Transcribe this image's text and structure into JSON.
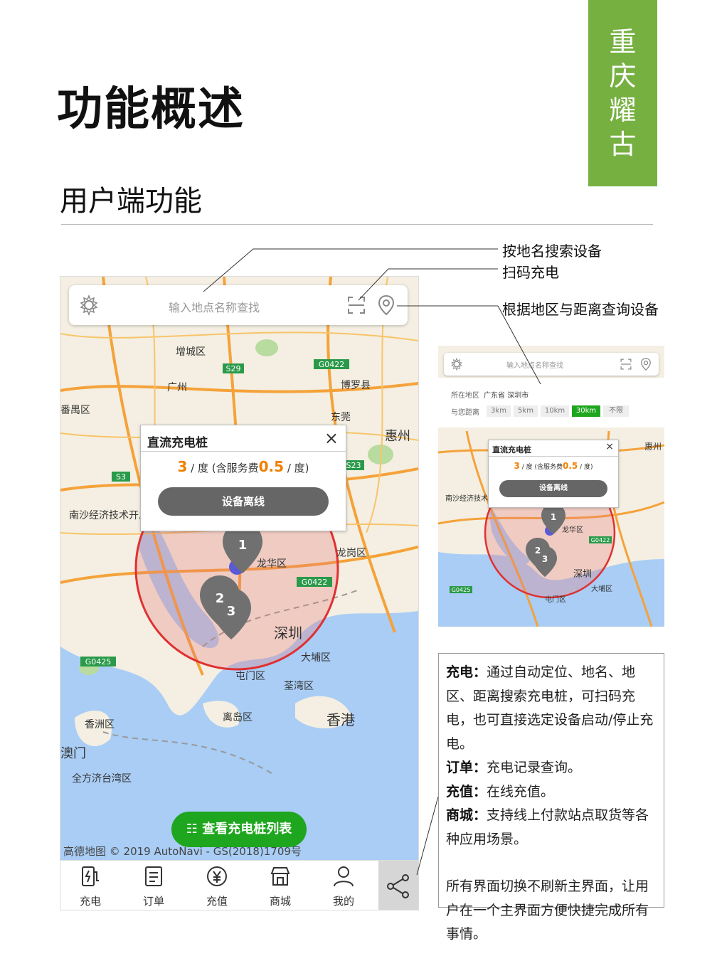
{
  "brand": {
    "chars": [
      "重",
      "庆",
      "耀",
      "古"
    ],
    "color": "#76b041"
  },
  "page_title": "功能概述",
  "section_title": "用户端功能",
  "search": {
    "placeholder": "输入地点名称查找"
  },
  "popup": {
    "title": "直流充电桩",
    "close": "×",
    "price_value": "3",
    "price_mid": " / 度 (含服务费",
    "service_fee": "0.5",
    "price_unit": " / 度)",
    "offline_button": "设备离线"
  },
  "map_labels": {
    "zengcheng": "增城区",
    "guangzhou": "广州",
    "huizhou": "惠州",
    "bolou": "博罗县",
    "nansha": "南沙经济技术开发区",
    "longhua": "龙华区",
    "longgang": "龙岗区",
    "shenzhen": "深圳",
    "dapeng": "大埔区",
    "tunmen": "屯门区",
    "quanwan": "荃湾区",
    "lidao": "离岛区",
    "hongkong": "香港",
    "xiangzhou": "香洲区",
    "macau": "澳门",
    "hengqin": "全方济台湾区",
    "dongguan": "东莞",
    "panyu": "番禺区",
    "road_s29": "S29",
    "road_g0422": "G0422",
    "road_s3": "S3",
    "road_g0425": "G0425",
    "road_23": "S23",
    "road_g0422b": "G0422"
  },
  "markers": [
    "1",
    "2",
    "3"
  ],
  "list_button": "☷ 查看充电桩列表",
  "copyright": "高德地图 © 2019 AutoNavi - GS(2018)1709号",
  "tabs": [
    {
      "label": "充电",
      "icon": "charge-icon"
    },
    {
      "label": "订单",
      "icon": "order-icon"
    },
    {
      "label": "充值",
      "icon": "recharge-icon"
    },
    {
      "label": "商城",
      "icon": "shop-icon"
    },
    {
      "label": "我的",
      "icon": "user-icon"
    }
  ],
  "filter": {
    "region_label": "所在地区",
    "region_value": "广东省  深圳市",
    "distance_label": "与您距离",
    "distances": [
      "3km",
      "5km",
      "10km",
      "30km",
      "不限"
    ],
    "active_distance": "30km"
  },
  "annotations": {
    "search_by_name": "按地名搜索设备",
    "scan_charge": "扫码充电",
    "search_by_region": "根据地区与距离查询设备"
  },
  "description": {
    "charge_title": "充电：",
    "charge_text": "通过自动定位、地名、地区、距离搜索充电桩，可扫码充电，也可直接选定设备启动/停止充电。",
    "order_title": "订单：",
    "order_text": "充电记录查询。",
    "recharge_title": "充值：",
    "recharge_text": "在线充值。",
    "shop_title": "商城：",
    "shop_text": "支持线上付款站点取货等各种应用场景。",
    "footer_text": "所有界面切换不刷新主界面，让用户在一个主界面方便快捷完成所有事情。"
  },
  "colors": {
    "accent_green": "#1fa61f",
    "price_orange": "#f08000",
    "radius_red": "#e03030",
    "sea": "#a9cdf5"
  }
}
